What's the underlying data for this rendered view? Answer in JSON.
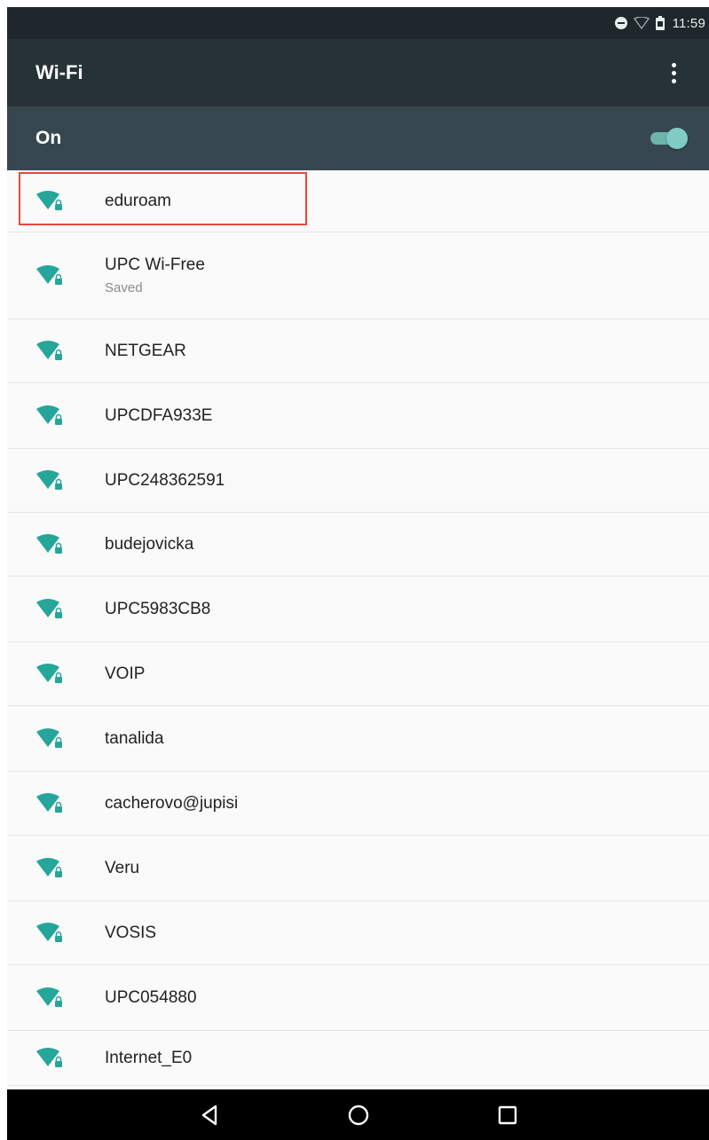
{
  "status_bar": {
    "time": "11:59",
    "icons": [
      "do-not-disturb-icon",
      "wifi-outline-icon",
      "battery-icon"
    ]
  },
  "app_bar": {
    "title": "Wi-Fi",
    "overflow_icon": "more-vert-icon"
  },
  "master_switch": {
    "label": "On",
    "checked": true
  },
  "networks": [
    {
      "ssid": "eduroam",
      "status": "",
      "icon": "wifi-lock-icon",
      "highlighted": true
    },
    {
      "ssid": "UPC Wi-Free",
      "status": "Saved",
      "icon": "wifi-lock-icon"
    },
    {
      "ssid": "NETGEAR",
      "status": "",
      "icon": "wifi-lock-icon"
    },
    {
      "ssid": "UPCDFA933E",
      "status": "",
      "icon": "wifi-lock-icon"
    },
    {
      "ssid": "UPC248362591",
      "status": "",
      "icon": "wifi-lock-icon"
    },
    {
      "ssid": "budejovicka",
      "status": "",
      "icon": "wifi-lock-icon"
    },
    {
      "ssid": "UPC5983CB8",
      "status": "",
      "icon": "wifi-lock-icon"
    },
    {
      "ssid": "VOIP",
      "status": "",
      "icon": "wifi-lock-icon"
    },
    {
      "ssid": "tanalida",
      "status": "",
      "icon": "wifi-lock-icon"
    },
    {
      "ssid": "cacherovo@jupisi",
      "status": "",
      "icon": "wifi-lock-icon"
    },
    {
      "ssid": "Veru",
      "status": "",
      "icon": "wifi-lock-icon"
    },
    {
      "ssid": "VOSIS",
      "status": "",
      "icon": "wifi-lock-icon"
    },
    {
      "ssid": "UPC054880",
      "status": "",
      "icon": "wifi-lock-icon"
    },
    {
      "ssid": "Internet_E0",
      "status": "",
      "icon": "wifi-lock-icon"
    }
  ],
  "nav_bar": [
    "back-icon",
    "home-icon",
    "recents-icon"
  ],
  "colors": {
    "status_bar": "#1e272b",
    "app_bar": "#263238",
    "switch_bar": "#37474f",
    "accent": "#80cbc4",
    "wifi_icon": "#26a69a",
    "highlight_box": "#e8493a"
  }
}
